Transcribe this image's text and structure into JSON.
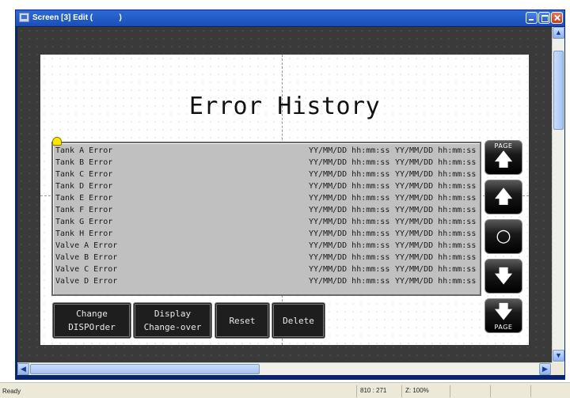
{
  "window": {
    "title": "Screen [3] Edit (            )"
  },
  "screen": {
    "title": "Error History",
    "rows": [
      {
        "name": "Tank A Error",
        "time1": "YY/MM/DD hh:mm:ss",
        "time2": "YY/MM/DD hh:mm:ss"
      },
      {
        "name": "Tank B Error",
        "time1": "YY/MM/DD hh:mm:ss",
        "time2": "YY/MM/DD hh:mm:ss"
      },
      {
        "name": "Tank C Error",
        "time1": "YY/MM/DD hh:mm:ss",
        "time2": "YY/MM/DD hh:mm:ss"
      },
      {
        "name": "Tank D Error",
        "time1": "YY/MM/DD hh:mm:ss",
        "time2": "YY/MM/DD hh:mm:ss"
      },
      {
        "name": "Tank E Error",
        "time1": "YY/MM/DD hh:mm:ss",
        "time2": "YY/MM/DD hh:mm:ss"
      },
      {
        "name": "Tank F Error",
        "time1": "YY/MM/DD hh:mm:ss",
        "time2": "YY/MM/DD hh:mm:ss"
      },
      {
        "name": "Tank G Error",
        "time1": "YY/MM/DD hh:mm:ss",
        "time2": "YY/MM/DD hh:mm:ss"
      },
      {
        "name": "Tank H Error",
        "time1": "YY/MM/DD hh:mm:ss",
        "time2": "YY/MM/DD hh:mm:ss"
      },
      {
        "name": "Valve A Error",
        "time1": "YY/MM/DD hh:mm:ss",
        "time2": "YY/MM/DD hh:mm:ss"
      },
      {
        "name": "Valve B Error",
        "time1": "YY/MM/DD hh:mm:ss",
        "time2": "YY/MM/DD hh:mm:ss"
      },
      {
        "name": "Valve C Error",
        "time1": "YY/MM/DD hh:mm:ss",
        "time2": "YY/MM/DD hh:mm:ss"
      },
      {
        "name": "Valve D Error",
        "time1": "YY/MM/DD hh:mm:ss",
        "time2": "YY/MM/DD hh:mm:ss"
      }
    ],
    "side_buttons": {
      "page_up_caption": "PAGE",
      "page_down_caption": "PAGE",
      "page_up_icon": "arrow-up-icon",
      "up_icon": "arrow-up-icon",
      "center_icon": "circle-icon",
      "down_icon": "arrow-down-icon",
      "page_down_icon": "arrow-down-icon"
    },
    "buttons": {
      "change_line1": "Change",
      "change_line2": "DISPOrder",
      "display_line1": "Display",
      "display_line2": "Change-over",
      "reset": "Reset",
      "delete": "Delete"
    }
  },
  "statusbar": {
    "ready": "Ready",
    "coords": "810 : 271",
    "zoom": "Z: 100%"
  },
  "colors": {
    "titlebar": "#1b4fb8",
    "list_bg": "#c0c0c0",
    "button_bg": "#1e1e1e",
    "editor_bg": "#3a3a3a"
  }
}
